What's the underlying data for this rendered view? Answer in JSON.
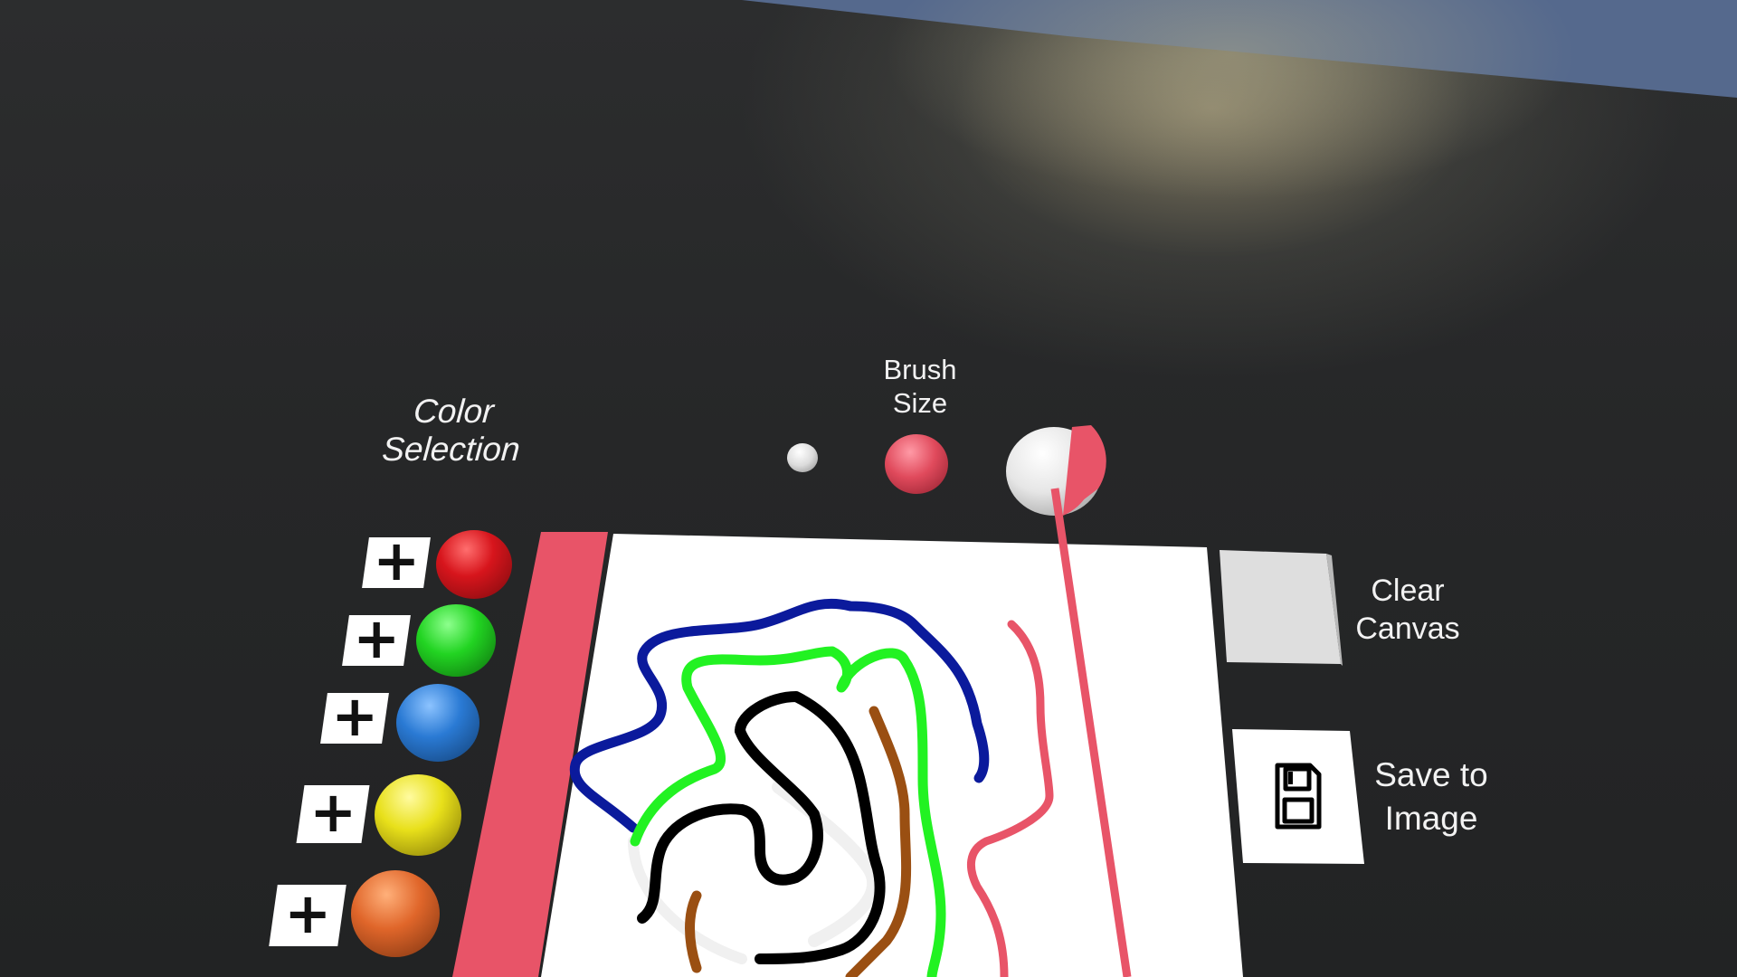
{
  "color_selection": {
    "title": "Color\nSelection",
    "swatches": [
      {
        "color_name": "red",
        "hex": "#d7151c",
        "add_label": "+"
      },
      {
        "color_name": "green",
        "hex": "#22d422",
        "add_label": "+"
      },
      {
        "color_name": "blue",
        "hex": "#2a7ad4",
        "add_label": "+"
      },
      {
        "color_name": "yellow",
        "hex": "#e8e01a",
        "add_label": "+"
      },
      {
        "color_name": "orange",
        "hex": "#e0662a",
        "add_label": "+"
      }
    ]
  },
  "brush_size": {
    "title": "Brush\nSize",
    "options": [
      "small",
      "medium",
      "large"
    ],
    "selected": "large",
    "highlight_color": "#e85468"
  },
  "canvas": {
    "border_color": "#e85468",
    "stroke_colors": [
      "#0b1a9c",
      "#22f222",
      "#000000",
      "#9a4f12",
      "#e85468",
      "#f0f0f0"
    ]
  },
  "actions": {
    "clear_label": "Clear\nCanvas",
    "save_label": "Save to\nImage",
    "save_icon": "floppy-disk-icon"
  },
  "pointer": {
    "ray_color": "#e85468"
  }
}
